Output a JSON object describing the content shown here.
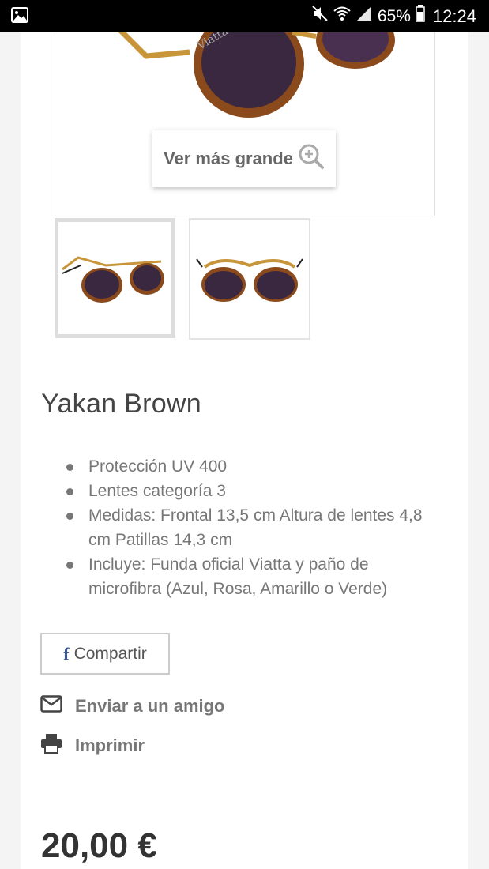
{
  "status_bar": {
    "battery": "65%",
    "time": "12:24",
    "icons": [
      "image-icon",
      "mute-icon",
      "wifi-icon",
      "signal-icon",
      "battery-icon"
    ]
  },
  "product": {
    "zoom_label": "Ver más grande",
    "title": "Yakan Brown",
    "features": [
      "Protección UV 400",
      "Lentes categoría 3",
      "Medidas: Frontal 13,5 cm  Altura de lentes 4,8 cm  Patillas 14,3 cm",
      "Incluye: Funda oficial Viatta y paño de microfibra (Azul, Rosa, Amarillo o Verde)"
    ],
    "brand_on_temple": "Viatta",
    "price": "20,00 €"
  },
  "actions": {
    "share_label": "Compartir",
    "send_friend_label": "Enviar a un amigo",
    "print_label": "Imprimir"
  },
  "colors": {
    "facebook": "#3b5998",
    "lens": "#3a2740",
    "frame_gold": "#c8953a",
    "tortoise": "#8a4a1c"
  }
}
